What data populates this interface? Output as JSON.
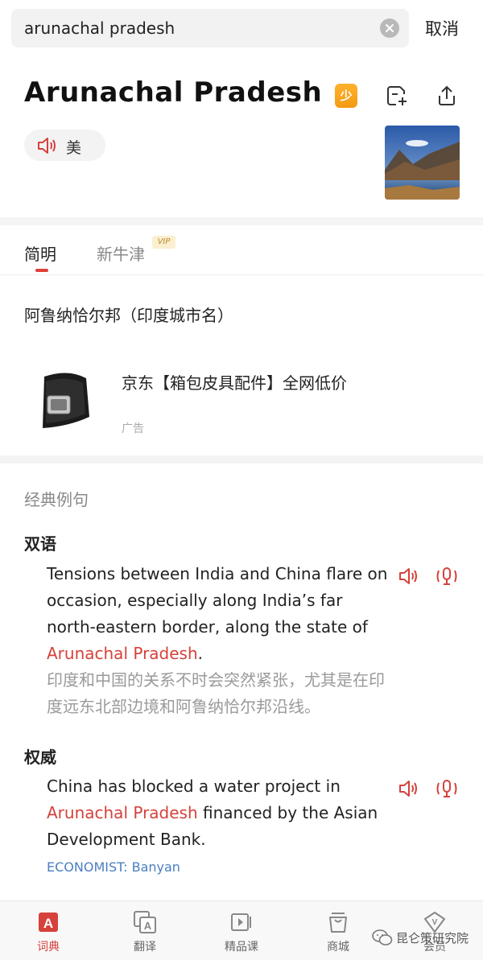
{
  "search": {
    "query": "arunachal pradesh",
    "cancel_label": "取消"
  },
  "header": {
    "word": "Arunachal Pradesh",
    "badge_char": "少",
    "pron_label": "美"
  },
  "tabs": [
    {
      "label": "简明",
      "active": true
    },
    {
      "label": "新牛津",
      "active": false,
      "badge": "VIP"
    }
  ],
  "definition": "阿鲁纳恰尔邦（印度城市名）",
  "ad": {
    "title": "京东【箱包皮具配件】全网低价",
    "label": "广告"
  },
  "examples": {
    "section_title": "经典例句",
    "groups": [
      {
        "title": "双语",
        "en_before": "Tensions between India and China flare on occasion, especially along India’s far north-eastern border, along the state of ",
        "en_highlight": "Arunachal Pradesh",
        "en_after": ".",
        "zh": "印度和中国的关系不时会突然紧张，尤其是在印度远东北部边境和阿鲁纳恰尔邦沿线。"
      },
      {
        "title": "权威",
        "en_before": "China has blocked a water project in ",
        "en_highlight": "Arunachal Pradesh",
        "en_after": " financed by the Asian Development Bank.",
        "source": "ECONOMIST: Banyan"
      }
    ]
  },
  "bottom_nav": [
    {
      "label": "词典",
      "icon": "dictionary-icon",
      "active": true
    },
    {
      "label": "翻译",
      "icon": "translate-icon",
      "active": false
    },
    {
      "label": "精品课",
      "icon": "course-icon",
      "active": false
    },
    {
      "label": "商城",
      "icon": "shop-icon",
      "active": false
    },
    {
      "label": "会员",
      "icon": "vip-icon",
      "active": false
    }
  ],
  "watermark": "昆仑策研究院",
  "colors": {
    "accent": "#d6413b",
    "link": "#4a7fc1",
    "badge": "#f39a12"
  }
}
